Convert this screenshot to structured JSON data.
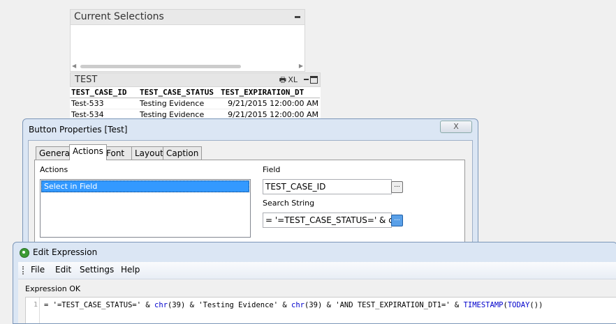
{
  "current_selections": {
    "title": "Current Selections"
  },
  "table_box": {
    "title": "TEST",
    "icons": {
      "print": "printer-icon",
      "xl": "XL",
      "min": "minimize-icon",
      "max": "maximize-icon"
    },
    "columns": [
      "TEST_CASE_ID",
      "TEST_CASE_STATUS",
      "TEST_EXPIRATION_DT"
    ],
    "rows": [
      [
        "Test-533",
        "Testing Evidence",
        "9/21/2015 12:00:00 AM"
      ],
      [
        "Test-534",
        "Testing Evidence",
        "9/21/2015 12:00:00 AM"
      ]
    ]
  },
  "button_properties": {
    "title": "Button Properties [Test]",
    "close_label": "X",
    "tabs": [
      "General",
      "Actions",
      "Font",
      "Layout",
      "Caption"
    ],
    "actions_label": "Actions",
    "actions_selected": "Select in Field",
    "field_label": "Field",
    "field_value": "TEST_CASE_ID",
    "search_label": "Search String",
    "search_value": "= '=TEST_CASE_STATUS=' & chr",
    "ellipsis": "..."
  },
  "edit_expression": {
    "title": "Edit Expression",
    "menu": [
      "File",
      "Edit",
      "Settings",
      "Help"
    ],
    "status": "Expression OK",
    "line_number": "1",
    "code_parts": [
      {
        "t": "= '=TEST_CASE_STATUS=' & ",
        "k": false
      },
      {
        "t": "chr",
        "k": true
      },
      {
        "t": "(39) & 'Testing Evidence' & ",
        "k": false
      },
      {
        "t": "chr",
        "k": true
      },
      {
        "t": "(39) & 'AND TEST_EXPIRATION_DT1=' & ",
        "k": false
      },
      {
        "t": "TIMESTAMP",
        "k": true
      },
      {
        "t": "(",
        "k": false
      },
      {
        "t": "TODAY",
        "k": true
      },
      {
        "t": "())",
        "k": false
      }
    ]
  }
}
